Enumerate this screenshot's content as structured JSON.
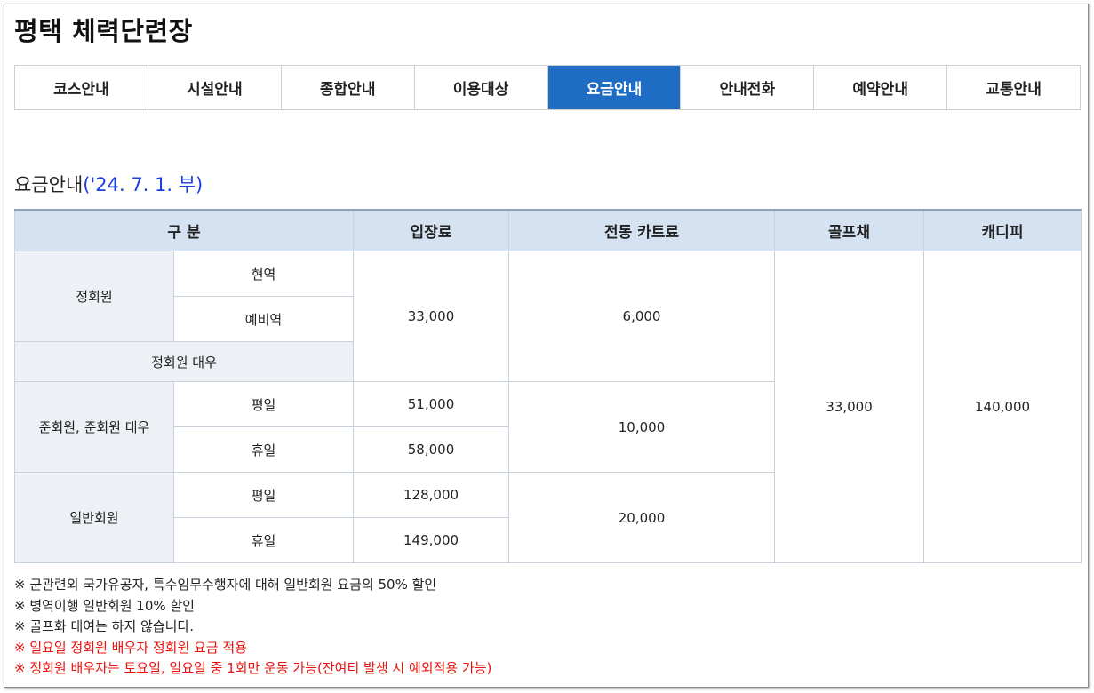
{
  "page": {
    "title": "평택 체력단련장"
  },
  "tabs": [
    {
      "label": "코스안내",
      "active": false
    },
    {
      "label": "시설안내",
      "active": false
    },
    {
      "label": "종합안내",
      "active": false
    },
    {
      "label": "이용대상",
      "active": false
    },
    {
      "label": "요금안내",
      "active": true
    },
    {
      "label": "안내전화",
      "active": false
    },
    {
      "label": "예약안내",
      "active": false
    },
    {
      "label": "교통안내",
      "active": false
    }
  ],
  "section": {
    "title": "요금안내",
    "date": "('24. 7. 1. 부)"
  },
  "table": {
    "headers": {
      "category": "구 분",
      "entry": "입장료",
      "cart": "전동 카트료",
      "club": "골프채",
      "caddie": "캐디피"
    },
    "regular": {
      "label": "정회원",
      "sub1": "현역",
      "sub2": "예비역",
      "equiv": "정회원 대우",
      "entry": "33,000",
      "cart": "6,000"
    },
    "associate": {
      "label": "준회원, 준회원 대우",
      "weekday": "평일",
      "holiday": "휴일",
      "entry_weekday": "51,000",
      "entry_holiday": "58,000",
      "cart": "10,000"
    },
    "general": {
      "label": "일반회원",
      "weekday": "평일",
      "holiday": "휴일",
      "entry_weekday": "128,000",
      "entry_holiday": "149,000",
      "cart": "20,000"
    },
    "club_fee": "33,000",
    "caddie_fee": "140,000"
  },
  "notes": [
    {
      "text": "※ 군관련외 국가유공자, 특수임무수행자에 대해 일반회원 요금의 50% 할인",
      "highlight": false
    },
    {
      "text": "※ 병역이행 일반회원 10% 할인",
      "highlight": false
    },
    {
      "text": "※ 골프화 대여는 하지 않습니다.",
      "highlight": false
    },
    {
      "text": "※ 일요일 정회원 배우자 정회원 요금 적용",
      "highlight": true
    },
    {
      "text": "※ 정회원 배우자는 토요일, 일요일 중 1회만 운동 가능(잔여티 발생 시 예외적용 가능)",
      "highlight": true
    }
  ],
  "colors": {
    "accent": "#1f6cc4",
    "header_bg": "#d5e2f2",
    "category_bg": "#edf0f5",
    "date_blue": "#1a3ee0",
    "note_red": "#e8130e"
  }
}
